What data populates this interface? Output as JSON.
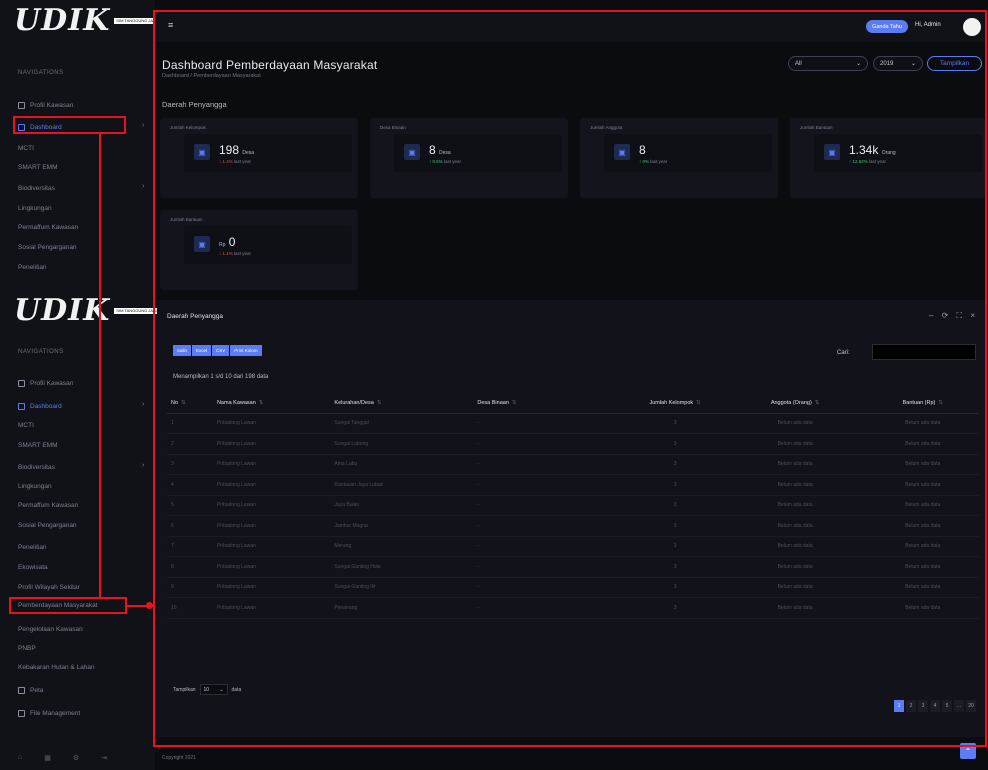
{
  "sidebar_top": {
    "logo_text": "UDIK",
    "logo_sub": "SIM TANGGUNG JAWAB PERUSAHAAN",
    "section": "NAVIGATIONS",
    "items": [
      "Profil Kawasan",
      "Dashboard",
      "MCTI",
      "SMART EMM",
      "Biodiversitas",
      "Lingkungan",
      "Permaffum Kawasan",
      "Sosial Pengarganan",
      "Penelitian"
    ]
  },
  "sidebar_bottom": {
    "logo_text": "UDIK",
    "logo_sub": "SIM TANGGUNG JAWAB PERUSAHAAN",
    "section": "NAVIGATIONS",
    "items": [
      "Profil Kawasan",
      "Dashboard",
      "MCTI",
      "SMART EMM",
      "Biodiversitas",
      "Lingkungan",
      "Permaffum Kawasan",
      "Sosial Pengarganan",
      "Penelitian",
      "Ekowisata",
      "Profil Wilayah Sekitar",
      "Pemberdayaan Masyarakat",
      "Pengelolaan Kawasan",
      "PNBP",
      "Kebakaran Hutan & Lahan",
      "Peta",
      "File Management"
    ],
    "footer_icons": [
      "home-icon",
      "grid-icon",
      "settings-icon",
      "logout-icon"
    ]
  },
  "topbar": {
    "menu_icon": "≡",
    "pill": "Ganda Tahu",
    "greeting": "Hi, Admin"
  },
  "header": {
    "title": "Dashboard Pemberdayaan Masyarakat",
    "breadcrumb": "Dashboard  /  Pemberdayaan Masyarakat",
    "filter1": "All",
    "filter2": "2019",
    "button": "Tampilkan"
  },
  "section_label": "Daerah Penyangga",
  "cards": [
    {
      "title": "Jumlah Kelompok",
      "value": "198",
      "unit": "Desa",
      "change": "1.4%",
      "change_dir": "down",
      "note": "last year"
    },
    {
      "title": "Desa Binaan",
      "value": "8",
      "unit": "Desa",
      "change": "0.5%",
      "change_dir": "up",
      "note": "last year"
    },
    {
      "title": "Jumlah Anggota",
      "value": "8",
      "unit": "",
      "change": "0%",
      "change_dir": "up",
      "note": "last year"
    },
    {
      "title": "Jumlah Bantuan",
      "value": "1.34k",
      "unit": "Orang",
      "change": "12.62%",
      "change_dir": "up",
      "note": "last year"
    },
    {
      "title": "Jumlah Bantuan",
      "value": "0",
      "unit": "Rp",
      "change": "1.1%",
      "change_dir": "down",
      "note": "last year"
    }
  ],
  "table": {
    "title": "Daerah Penyangga",
    "tools": "– ⟳ ⛶ ×",
    "exports": [
      "Salin",
      "Excel",
      "CSV",
      "Print Kolom"
    ],
    "search_label": "Cari:",
    "showing": "Menampilkan 1 s/d 10 dari 198 data",
    "headers": [
      "No",
      "Nama Kawasan",
      "Kelurahan/Desa",
      "Desa Binaan",
      "Jumlah Kelompok",
      "Anggota (Orang)",
      "Bantuan (Rp)"
    ],
    "rows": [
      [
        "1",
        "Pribadong Lawan",
        "Sungai Tanggal",
        "-",
        "3",
        "Belum ada data",
        "Belum ada data"
      ],
      [
        "2",
        "Pribadong Lawan",
        "Sungai Lubong",
        "-",
        "3",
        "Belum ada data",
        "Belum ada data"
      ],
      [
        "3",
        "Pribadong Lawan",
        "Ama Lubu",
        "-",
        "3",
        "Belum ada data",
        "Belum ada data"
      ],
      [
        "4",
        "Pribadong Lawan",
        "Rantauan Jaya Lubuk",
        "-",
        "3",
        "Belum ada data",
        "Belum ada data"
      ],
      [
        "5",
        "Pribadong Lawan",
        "Jaya Bulan",
        "-",
        "3",
        "Belum ada data",
        "Belum ada data"
      ],
      [
        "6",
        "Pribadong Lawan",
        "Jambur Mugna",
        "-",
        "3",
        "Belum ada data",
        "Belum ada data"
      ],
      [
        "7",
        "Pribadong Lawan",
        "Merang",
        "-",
        "3",
        "Belum ada data",
        "Belum ada data"
      ],
      [
        "8",
        "Pribadong Lawan",
        "Sungai Ganting Hulu",
        "-",
        "3",
        "Belum ada data",
        "Belum ada data"
      ],
      [
        "9",
        "Pribadong Lawan",
        "Sungai Ganting Ilir",
        "-",
        "3",
        "Belum ada data",
        "Belum ada data"
      ],
      [
        "10",
        "Pribadong Lawan",
        "Penanang",
        "-",
        "3",
        "Belum ada data",
        "Belum ada data"
      ]
    ],
    "perpage_label": "Tampilkan",
    "perpage_value": "10",
    "perpage_suffix": "data",
    "pages": [
      "1",
      "2",
      "3",
      "4",
      "5",
      "...",
      "20"
    ]
  },
  "footer": "Copyright 2021"
}
